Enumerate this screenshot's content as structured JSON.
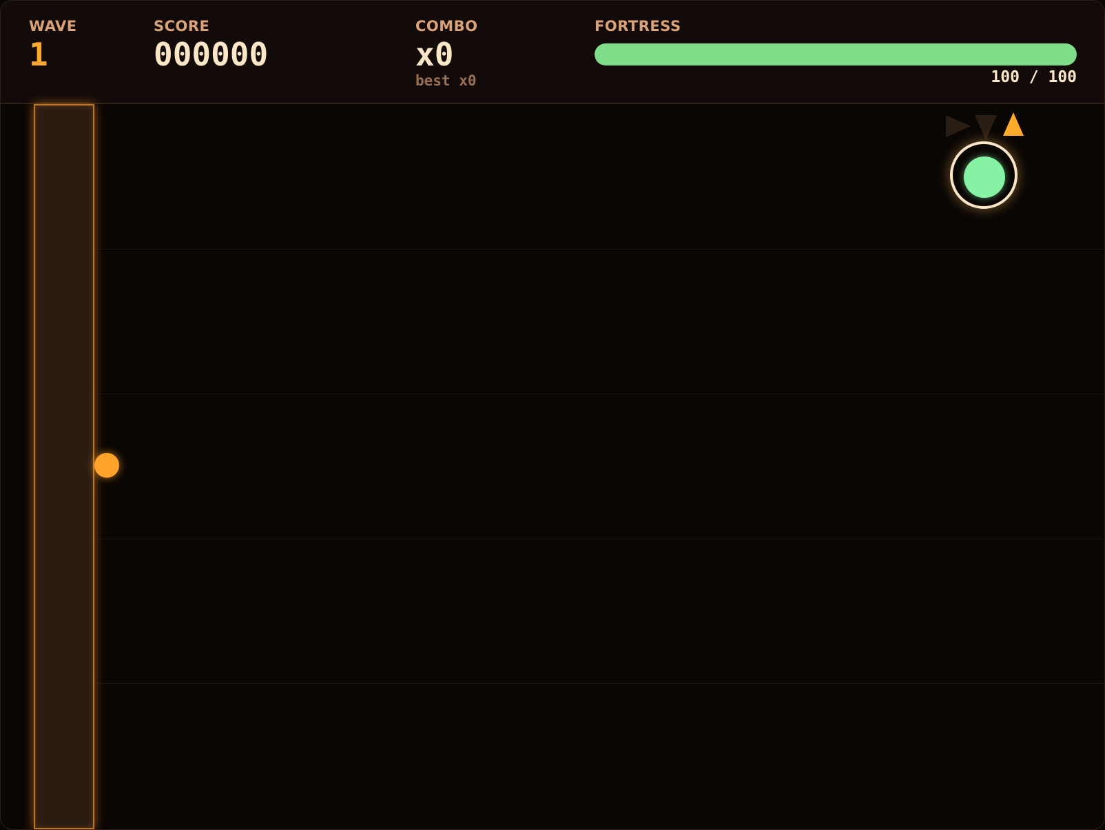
{
  "hud": {
    "wave": {
      "label": "WAVE",
      "value": "1"
    },
    "score": {
      "label": "SCORE",
      "value": "000000"
    },
    "combo": {
      "label": "COMBO",
      "value": "x0",
      "best": "best x0"
    },
    "fortress": {
      "label": "FORTRESS",
      "readout": "100 / 100",
      "level_fraction": 1.0
    }
  },
  "colors": {
    "accent": "#ffaa2c",
    "health": "#80de8a",
    "player_core": "#86f2a4",
    "text_primary": "#fbe6c8",
    "text_label": "#d9a277"
  },
  "field": {
    "lanes": 5,
    "direction_hints": [
      {
        "icon": "arrow-right-icon",
        "active": false
      },
      {
        "icon": "arrow-down-icon",
        "active": false
      },
      {
        "icon": "arrow-up-icon",
        "active": true
      }
    ]
  }
}
